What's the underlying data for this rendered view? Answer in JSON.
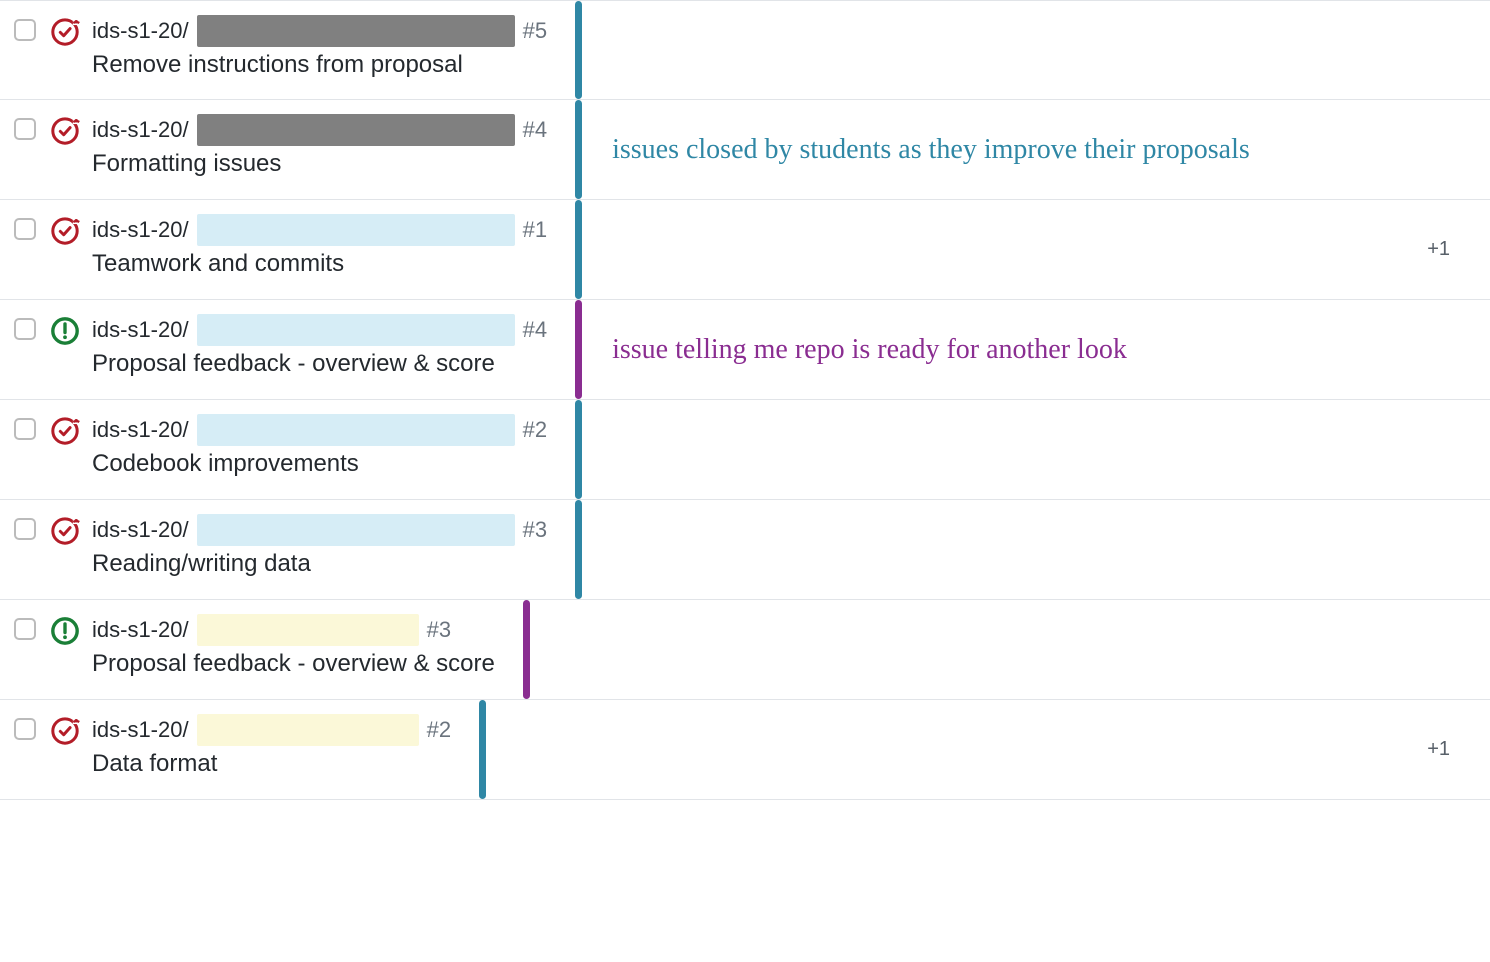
{
  "repo_prefix": "ids-s1-20/",
  "annotations": {
    "closed": "issues closed by students as they improve their proposals",
    "open": "issue telling me repo is ready for another look"
  },
  "issues": [
    {
      "status": "closed",
      "redact": "gray",
      "redact_w": 318,
      "num": "#5",
      "title": "Remove instructions from proposal",
      "marker": "teal",
      "annotation": null,
      "extra": null
    },
    {
      "status": "closed",
      "redact": "gray",
      "redact_w": 318,
      "num": "#4",
      "title": "Formatting issues",
      "marker": "teal",
      "annotation": "closed",
      "extra": null
    },
    {
      "status": "closed",
      "redact": "blue",
      "redact_w": 318,
      "num": "#1",
      "title": "Teamwork and commits",
      "marker": "teal",
      "annotation": null,
      "extra": "+1"
    },
    {
      "status": "open",
      "redact": "blue",
      "redact_w": 318,
      "num": "#4",
      "title": "Proposal feedback - overview & score",
      "marker": "purple",
      "annotation": "open",
      "extra": null
    },
    {
      "status": "closed",
      "redact": "blue",
      "redact_w": 318,
      "num": "#2",
      "title": "Codebook improvements",
      "marker": "teal",
      "annotation": null,
      "extra": null
    },
    {
      "status": "closed",
      "redact": "blue",
      "redact_w": 318,
      "num": "#3",
      "title": "Reading/writing data",
      "marker": "teal",
      "annotation": null,
      "extra": null
    },
    {
      "status": "open",
      "redact": "yellow",
      "redact_w": 222,
      "num": "#3",
      "title": "Proposal feedback - overview & score",
      "marker": "purple",
      "annotation": null,
      "extra": null
    },
    {
      "status": "closed",
      "redact": "yellow",
      "redact_w": 222,
      "num": "#2",
      "title": "Data format",
      "marker": "teal",
      "annotation": null,
      "extra": "+1"
    }
  ]
}
